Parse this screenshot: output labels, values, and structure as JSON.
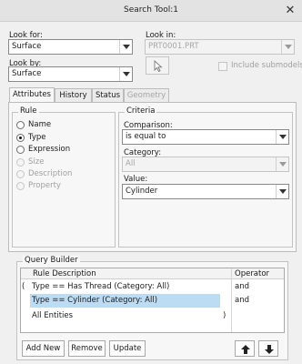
{
  "window": {
    "title": "Search Tool:1"
  },
  "look_for": {
    "label": "Look for:",
    "value": "Surface"
  },
  "look_by": {
    "label": "Look by:",
    "value": "Surface"
  },
  "look_in": {
    "label": "Look in:",
    "value": "PRT0001.PRT"
  },
  "include_submodels": {
    "label": "Include submodels"
  },
  "tabs": [
    {
      "label": "Attributes"
    },
    {
      "label": "History"
    },
    {
      "label": "Status"
    },
    {
      "label": "Geometry"
    }
  ],
  "rule": {
    "title": "Rule",
    "options": [
      {
        "label": "Name"
      },
      {
        "label": "Type"
      },
      {
        "label": "Expression"
      },
      {
        "label": "Size"
      },
      {
        "label": "Description"
      },
      {
        "label": "Property"
      }
    ]
  },
  "criteria": {
    "title": "Criteria",
    "comparison": {
      "label": "Comparison:",
      "value": "is equal to"
    },
    "category": {
      "label": "Category:",
      "value": "All"
    },
    "value": {
      "label": "Value:",
      "value": "Cylinder"
    }
  },
  "query_builder": {
    "title": "Query Builder",
    "columns": {
      "description": "Rule Description",
      "operator": "Operator"
    },
    "rows": [
      {
        "open": "(",
        "text": "Type   ==  Has Thread (Category: All)",
        "close": "",
        "op": "and"
      },
      {
        "open": "",
        "text": "Type   ==  Cylinder (Category: All)",
        "close": "",
        "op": "and"
      },
      {
        "open": "",
        "text": "All Entities",
        "close": ")",
        "op": ""
      }
    ]
  },
  "buttons": {
    "add_new": "Add New",
    "remove": "Remove",
    "update": "Update"
  },
  "colors": {
    "selection": "#bcdcf4",
    "window_bg": "#f0f0f0"
  }
}
